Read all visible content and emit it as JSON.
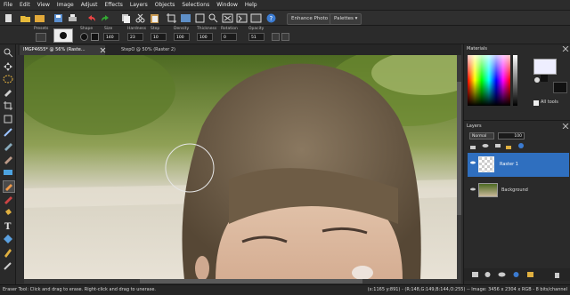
{
  "menu": [
    "File",
    "Edit",
    "View",
    "Image",
    "Adjust",
    "Effects",
    "Layers",
    "Objects",
    "Selections",
    "Window",
    "Help"
  ],
  "toolbar": {
    "enhance_photo": "Enhance Photo ▾",
    "palettes": "Palettes ▾"
  },
  "options": {
    "presets_label": "Presets",
    "shape_label": "Shape",
    "size_label": "Size",
    "size_value": "140",
    "hardness_label": "Hardness",
    "hardness_value": "23",
    "step_label": "Step",
    "step_value": "10",
    "density_label": "Density",
    "density_value": "100",
    "thickness_label": "Thickness",
    "thickness_value": "100",
    "rotation_label": "Rotation",
    "rotation_value": "0",
    "opacity_label": "Opacity",
    "opacity_value": "51"
  },
  "tabs": [
    {
      "label": "IMGP4655* @ 56% (Raste...",
      "active": true
    },
    {
      "label": "StepO @ 50% (Raster 2)",
      "active": false
    }
  ],
  "materials": {
    "title": "Materials",
    "all_tools": "All tools"
  },
  "layers": {
    "title": "Layers",
    "blend_mode": "Normal",
    "opacity": "100",
    "items": [
      {
        "name": "Raster 1",
        "selected": true
      },
      {
        "name": "Background",
        "selected": false
      }
    ]
  },
  "status": {
    "left": "Eraser Tool: Click and drag to erase. Right-click and drag to unerase.",
    "right": "(x:1165 y:891) - (R:148,G:149,B:144,O:255) -- Image: 3456 x 2304 x RGB - 8 bits/channel"
  },
  "colors": {
    "layer_selected": "#2f6fbf",
    "panel": "#2a2a2a"
  }
}
